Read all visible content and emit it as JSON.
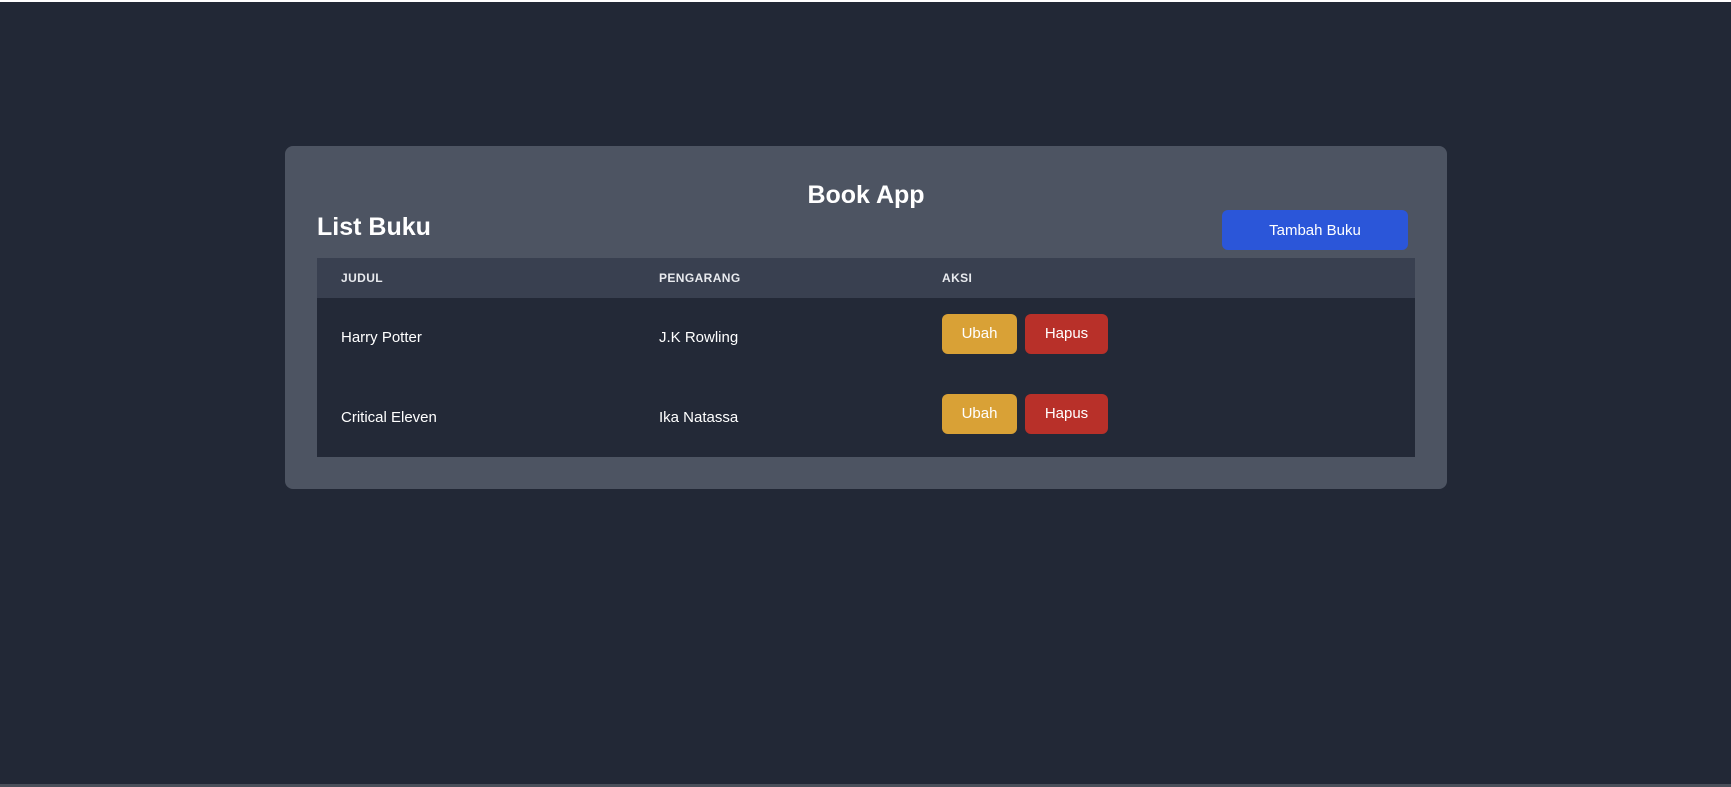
{
  "header": {
    "app_title": "Book App",
    "list_title": "List Buku",
    "add_button_label": "Tambah Buku"
  },
  "table": {
    "columns": [
      "JUDUL",
      "PENGARANG",
      "AKSI"
    ],
    "rows": [
      {
        "judul": "Harry Potter",
        "pengarang": "J.K Rowling",
        "edit_label": "Ubah",
        "delete_label": "Hapus"
      },
      {
        "judul": "Critical Eleven",
        "pengarang": "Ika Natassa",
        "edit_label": "Ubah",
        "delete_label": "Hapus"
      }
    ]
  },
  "colors": {
    "background": "#222836",
    "card": "#4d5462",
    "table_header": "#394050",
    "table_body": "#232937",
    "primary": "#2b56d9",
    "edit": "#d9a136",
    "delete": "#b83029"
  }
}
